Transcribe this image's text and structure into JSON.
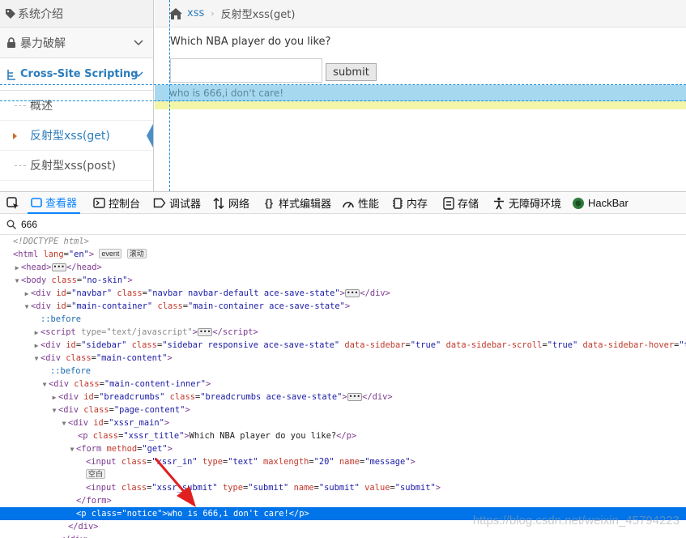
{
  "sidebar": {
    "items": [
      {
        "label": "系统介绍"
      },
      {
        "label": "暴力破解"
      },
      {
        "label": "Cross-Site Scripting"
      }
    ],
    "subitems": [
      {
        "label": "概述"
      },
      {
        "label": "反射型xss(get)"
      },
      {
        "label": "反射型xss(post)"
      }
    ]
  },
  "breadcrumb": {
    "root": "xss",
    "current": "反射型xss(get)"
  },
  "main": {
    "question": "Which NBA player do you like?",
    "input_value": "",
    "submit_label": "submit",
    "notice": "who is 666,i don't care!"
  },
  "devtools": {
    "tabs": [
      {
        "label": "查看器"
      },
      {
        "label": "控制台"
      },
      {
        "label": "调试器"
      },
      {
        "label": "网络"
      },
      {
        "label": "样式编辑器"
      },
      {
        "label": "性能"
      },
      {
        "label": "内存"
      },
      {
        "label": "存储"
      },
      {
        "label": "无障碍环境"
      },
      {
        "label": "HackBar"
      }
    ],
    "search_value": "666",
    "badges": {
      "event": "event",
      "scroll": "滚动",
      "whitespace": "空白"
    }
  },
  "colors": {
    "accent": "#1a8bd6",
    "selected_row": "#0074e8",
    "notice_bg": "#a6d8f0",
    "notice_fg": "#5a8aa0"
  },
  "watermark": "https://blog.csdn.net/weixin_45794223"
}
